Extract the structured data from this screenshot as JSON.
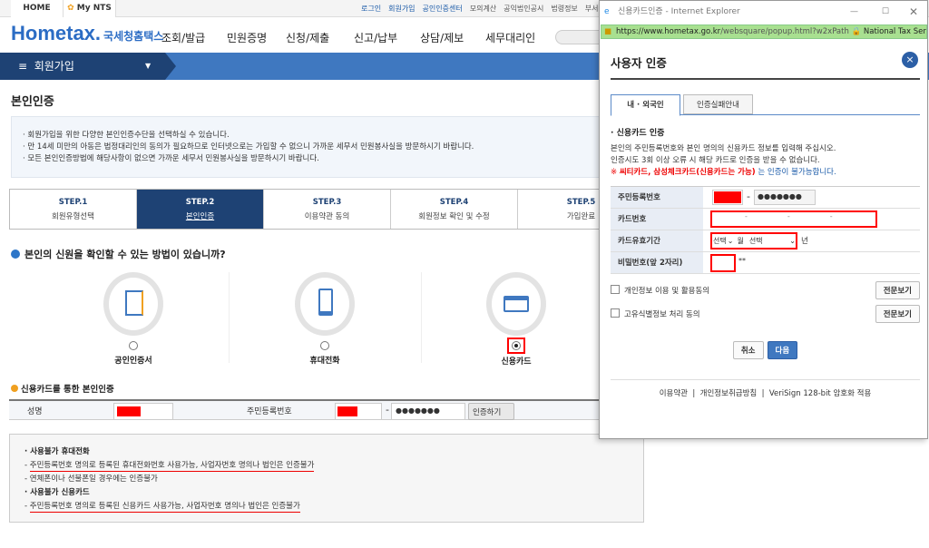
{
  "topbar": {
    "tabs": [
      "HOME",
      "My NTS"
    ],
    "links": [
      "로그인",
      "회원가입",
      "공인인증센터",
      "모의계산",
      "공익법인공시",
      "법령정보",
      "부서"
    ]
  },
  "header": {
    "logo": "Hometax.",
    "logo_sub": "국세청홈택스",
    "nav": [
      "조회/발급",
      "민원증명",
      "신청/제출",
      "신고/납부",
      "상담/제보",
      "세무대리인"
    ]
  },
  "menu": {
    "current": "회원가입"
  },
  "page": {
    "title": "본인인증",
    "info": [
      "회원가입을 위한 다양한 본인인증수단을 선택하실 수 있습니다.",
      "만 14세 미만의 아동은 법정대리인의 동의가 필요하므로 인터넷으로는 가입할 수 없으니 가까운 세무서 민원봉사실을 방문하시기 바랍니다.",
      "모든 본인인증방법에 해당사항이 없으면 가까운 세무서 민원봉사실을 방문하시기 바랍니다."
    ],
    "steps": [
      {
        "num": "STEP.1",
        "label": "회원유형선택"
      },
      {
        "num": "STEP.2",
        "label": "본인인증"
      },
      {
        "num": "STEP.3",
        "label": "이용약관 동의"
      },
      {
        "num": "STEP.4",
        "label": "회원정보 확인 및 수정"
      },
      {
        "num": "STEP.5",
        "label": "가입완료"
      }
    ],
    "question": "본인의 신원을 확인할 수 있는 방법이 있습니까?",
    "options": [
      "공인인증서",
      "휴대전화",
      "신용카드"
    ],
    "selected_option": "신용카드",
    "section": "신용카드를 통한 본인인증",
    "form": {
      "name_label": "성명",
      "rrn_label": "주민등록번호",
      "rrn_masked": "●●●●●●●",
      "verify_button": "인증하기"
    },
    "notice": {
      "phone_title": "사용불가 휴대전화",
      "phone_items": [
        "주민등록번호 명의로 등록된 휴대전화번호 사용가능, 사업자번호 명의나 법인은 인증불가",
        "연체폰이나 선불폰일 경우에는 인증불가"
      ],
      "card_title": "사용불가 신용카드",
      "card_items": [
        "주민등록번호 명의로 등록된 신용카드 사용가능, 사업자번호 명의나 법인은 인증불가"
      ]
    }
  },
  "popup": {
    "window_title": "신용카드인증 - Internet Explorer",
    "url_host": "https://www.hometax.go.kr",
    "url_path": "/websquare/popup.html?w2xPath",
    "site_identity": "National Tax Service [KR]",
    "heading": "사용자 인증",
    "close": "×",
    "tabs": [
      "내 · 외국인",
      "인증실패안내"
    ],
    "subtitle": "신용카드 인증",
    "desc": [
      "본인의 주민등록번호와 본인 명의의 신용카드 정보를 입력해 주십시오.",
      "인증시도 3회 이상 오류 시 해당 카드로 인증을 받을 수 없습니다."
    ],
    "warn_prefix": "※ ",
    "warn_red": "씨티카드, 삼성체크카드(신용카드는 가능)",
    "warn_blue": " 는 인증이 불가능합니다.",
    "fields": {
      "rrn": "주민등록번호",
      "rrn_masked": "●●●●●●●",
      "card_no": "카드번호",
      "expiry": "카드유효기간",
      "month_select": "선택",
      "month_unit": "월",
      "year_select": "선택",
      "year_unit": "년",
      "pin": "비밀번호(앞 2자리)",
      "pin_suffix": "**"
    },
    "agreements": [
      {
        "label": "개인정보 이용 및 활용동의",
        "button": "전문보기"
      },
      {
        "label": "고유식별정보 처리 동의",
        "button": "전문보기"
      }
    ],
    "cancel": "취소",
    "next": "다음",
    "footer": [
      "이용약관",
      "개인정보취급방침",
      "VeriSign 128-bit 암호화 적용"
    ]
  }
}
